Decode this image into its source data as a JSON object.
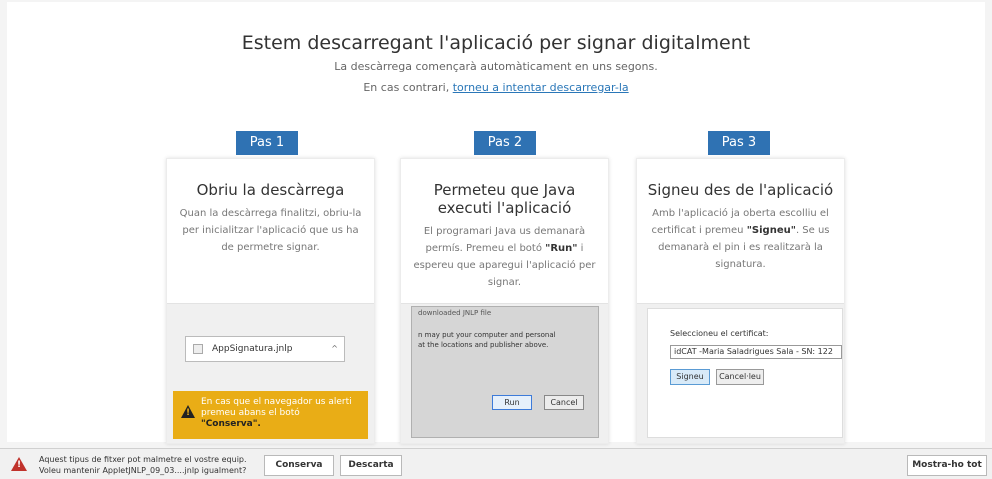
{
  "header": {
    "title": "Estem descarregant l'aplicació per signar digitalment",
    "subtitle": "La descàrrega començarà automàticament en uns segons.",
    "retry_prefix": "En cas contrari, ",
    "retry_link": "torneu a intentar descarregar-la"
  },
  "steps": [
    {
      "tab": "Pas 1",
      "title": "Obriu la descàrrega",
      "text": "Quan la descàrrega finalitzi, obriu-la per inicialitzar l'aplicació que us ha de permetre signar.",
      "mock": {
        "file": "AppSignatura.jnlp",
        "warning_text": "En cas que el navegador us alerti premeu abans el botó",
        "warning_bold": "\"Conserva\"."
      }
    },
    {
      "tab": "Pas 2",
      "title": "Permeteu que Java executi l'aplicació",
      "text_before": "El programari Java us demanarà permís. Premeu el botó ",
      "text_bold": "\"Run\"",
      "text_after": " i espereu que aparegui l'aplicació per signar.",
      "mock": {
        "line1": "downloaded JNLP file",
        "line2": "n may put your computer and personal",
        "line3": "at the locations and publisher above.",
        "run": "Run",
        "cancel": "Cancel"
      }
    },
    {
      "tab": "Pas 3",
      "title": "Signeu des de l'aplicació",
      "text_before": "Amb l'aplicació ja oberta escolliu el certificat i premeu ",
      "text_bold": "\"Signeu\"",
      "text_after": ". Se us demanarà el pin i es realitzarà la signatura.",
      "mock": {
        "label": "Seleccioneu el certificat:",
        "cert": "idCAT -Maria Saladrigues Sala - SN: 122",
        "sign": "Signeu",
        "cancel": "Cancel·leu"
      }
    }
  ],
  "download_bar": {
    "message_line1": "Aquest tipus de fitxer pot malmetre el vostre equip.",
    "message_line2": "Voleu mantenir AppletJNLP_09_03....jnlp igualment?",
    "keep": "Conserva",
    "discard": "Descarta",
    "show_all": "Mostra-ho tot"
  },
  "colors": {
    "accent": "#2f72b3",
    "warning": "#e9ad16",
    "danger": "#c0322b"
  }
}
